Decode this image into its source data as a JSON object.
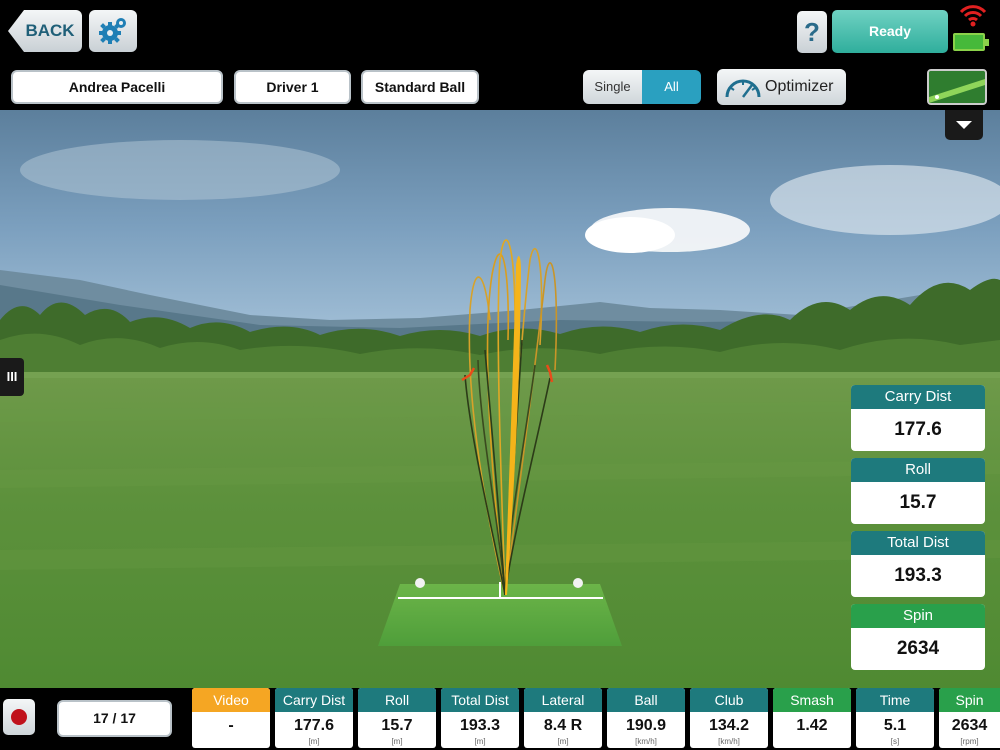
{
  "colors": {
    "teal": "#1e7a7d",
    "green": "#29a04b",
    "orange": "#f5a623",
    "ready": "#3dbba8",
    "active": "#2aa0c0"
  },
  "topbar": {
    "back_label": "BACK",
    "settings_icon": "gear-icon",
    "help_label": "?",
    "status_label": "Ready"
  },
  "selectors": {
    "player": "Andrea Pacelli",
    "club": "Driver 1",
    "ball": "Standard Ball"
  },
  "view_toggle": {
    "single_label": "Single",
    "all_label": "All",
    "selected": "All"
  },
  "optimizer": {
    "label": "Optimizer"
  },
  "side_handle": {
    "label": "III"
  },
  "stats": [
    {
      "label": "Carry Dist",
      "value": "177.6",
      "color": "#1e7a7d"
    },
    {
      "label": "Roll",
      "value": "15.7",
      "color": "#1e7a7d"
    },
    {
      "label": "Total Dist",
      "value": "193.3",
      "color": "#1e7a7d"
    },
    {
      "label": "Spin",
      "value": "2634",
      "color": "#29a04b"
    }
  ],
  "bottombar": {
    "shot_counter": "17 / 17",
    "metrics": [
      {
        "label": "Video",
        "value": "-",
        "unit": "",
        "color": "#f5a623"
      },
      {
        "label": "Carry Dist",
        "value": "177.6",
        "unit": "[m]",
        "color": "#1e7a7d"
      },
      {
        "label": "Roll",
        "value": "15.7",
        "unit": "[m]",
        "color": "#1e7a7d"
      },
      {
        "label": "Total Dist",
        "value": "193.3",
        "unit": "[m]",
        "color": "#1e7a7d"
      },
      {
        "label": "Lateral",
        "value": "8.4 R",
        "unit": "[m]",
        "color": "#1e7a7d"
      },
      {
        "label": "Ball",
        "value": "190.9",
        "unit": "[km/h]",
        "color": "#1e7a7d"
      },
      {
        "label": "Club",
        "value": "134.2",
        "unit": "[km/h]",
        "color": "#1e7a7d"
      },
      {
        "label": "Smash",
        "value": "1.42",
        "unit": "",
        "color": "#29a04b"
      },
      {
        "label": "Time",
        "value": "5.1",
        "unit": "[s]",
        "color": "#1e7a7d"
      },
      {
        "label": "Spin",
        "value": "2634",
        "unit": "[rpm]",
        "color": "#29a04b"
      }
    ]
  }
}
